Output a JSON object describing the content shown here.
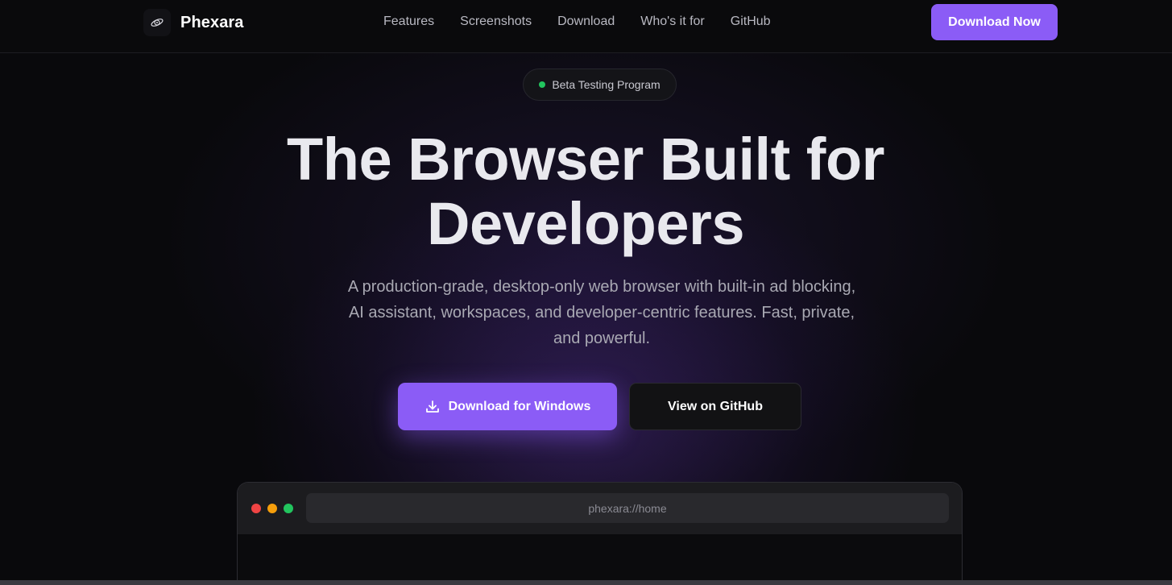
{
  "nav": {
    "brand": "Phexara",
    "links": [
      "Features",
      "Screenshots",
      "Download",
      "Who's it for",
      "GitHub"
    ],
    "cta": "Download Now"
  },
  "badge": {
    "text": "Beta Testing Program",
    "dot_color": "#22c55e"
  },
  "hero": {
    "title_line1": "The Browser Built for",
    "title_line2": "Developers",
    "subtitle": "A production-grade, desktop-only web browser with built-in ad blocking, AI assistant, workspaces, and developer-centric features. Fast, private, and powerful.",
    "primary_button": "Download for Windows",
    "secondary_button": "View on GitHub"
  },
  "mockup": {
    "url": "phexara://home"
  },
  "colors": {
    "accent": "#8b5cf6",
    "background": "#09090c"
  }
}
